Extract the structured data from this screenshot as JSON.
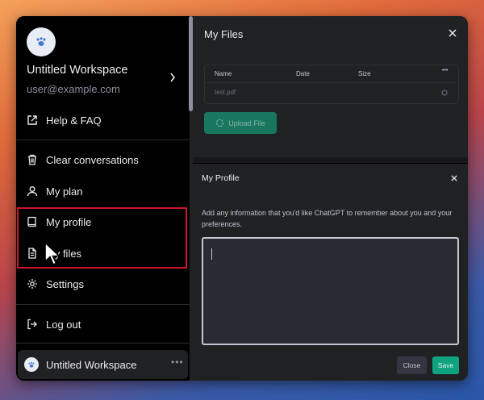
{
  "sidebar": {
    "workspace_name": "Untitled Workspace",
    "email": "user@example.com",
    "items": [
      {
        "label": "Help & FAQ",
        "icon": "external-link-icon"
      },
      {
        "label": "Clear conversations",
        "icon": "trash-icon"
      },
      {
        "label": "My plan",
        "icon": "user-icon"
      },
      {
        "label": "My profile",
        "icon": "book-icon"
      },
      {
        "label": "My files",
        "icon": "file-icon"
      },
      {
        "label": "Settings",
        "icon": "gear-icon"
      },
      {
        "label": "Log out",
        "icon": "logout-icon"
      }
    ],
    "bottom_workspace": "Untitled Workspace",
    "more": "•••"
  },
  "files": {
    "title": "My Files",
    "columns": [
      "Name",
      "Date",
      "Size"
    ],
    "more": "•••",
    "rows": [
      {
        "name": "test.pdf"
      }
    ],
    "upload_label": "Upload File"
  },
  "profile": {
    "title": "My Profile",
    "description": "Add any information that you'd like ChatGPT to remember about you and your preferences.",
    "textarea_value": "",
    "close_label": "Close",
    "save_label": "Save"
  },
  "colors": {
    "accent": "#10a37f",
    "highlight": "#d0152b",
    "sidebar_bg": "#000000",
    "panel_bg": "#202123"
  }
}
